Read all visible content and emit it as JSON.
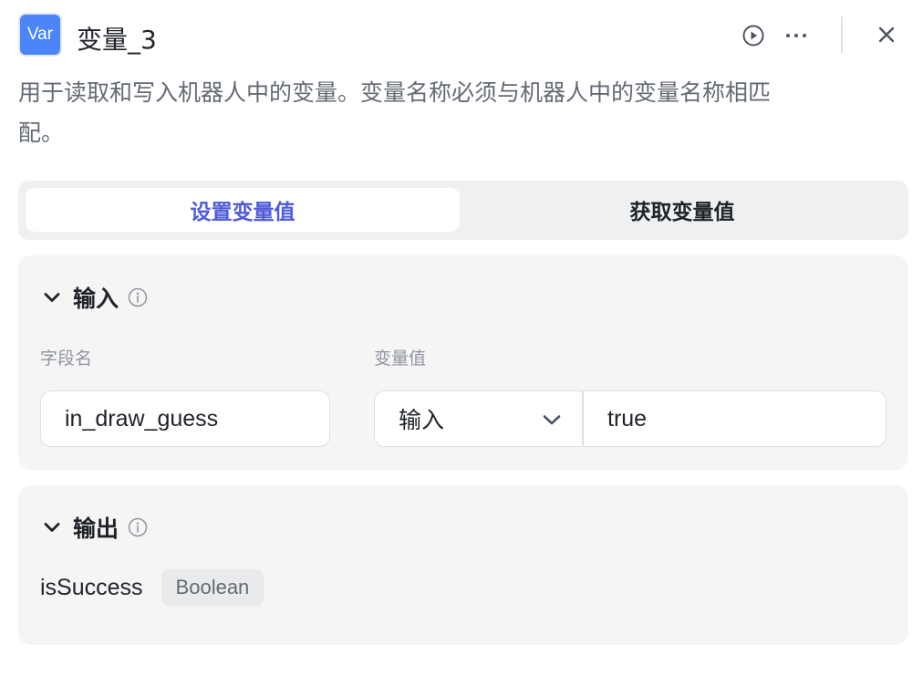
{
  "header": {
    "badge_label": "Var",
    "title": "变量_3",
    "icons": [
      "play-circle-icon",
      "more-icon",
      "close-icon"
    ],
    "accent_color": "#4c85f7"
  },
  "description_line1": "用于读取和写入机器人中的变量。变量名称必须与机器人中的变量名称相匹",
  "description_line2": "配。",
  "tabs": [
    {
      "label": "设置变量值",
      "active": true
    },
    {
      "label": "获取变量值",
      "active": false
    }
  ],
  "input_section": {
    "title": "输入",
    "field_name_label": "字段名",
    "variable_value_label": "变量值",
    "field_name_value": "in_draw_guess",
    "value_type": "输入",
    "value": "true"
  },
  "output_section": {
    "title": "输出",
    "output_name": "isSuccess",
    "output_type": "Boolean"
  }
}
